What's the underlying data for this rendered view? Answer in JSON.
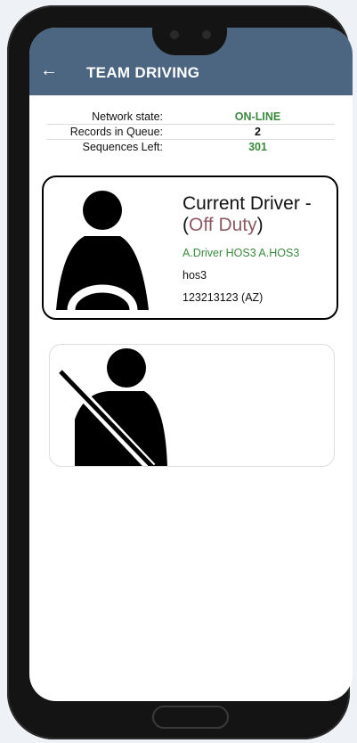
{
  "app_bar": {
    "back_icon": "arrow-left-icon",
    "back_glyph": "←",
    "title": "TEAM DRIVING",
    "color": "#4c6682"
  },
  "status": {
    "network_label": "Network state:",
    "network_value": "ON-LINE",
    "queue_label": "Records in Queue:",
    "queue_value": "2",
    "sequences_label": "Sequences Left:",
    "sequences_value": "301",
    "accent_green": "#3a8a3e"
  },
  "current_driver": {
    "icon": "driver-at-wheel-icon",
    "title": "Current Driver -",
    "status_open": "(",
    "status": "Off Duty",
    "status_close": ")",
    "name": "A.Driver HOS3 A.HOS3",
    "username": "hos3",
    "license": "123213123 (AZ)",
    "status_color": "#8e5b65"
  },
  "co_driver": {
    "icon": "seatbelt-passenger-icon"
  }
}
